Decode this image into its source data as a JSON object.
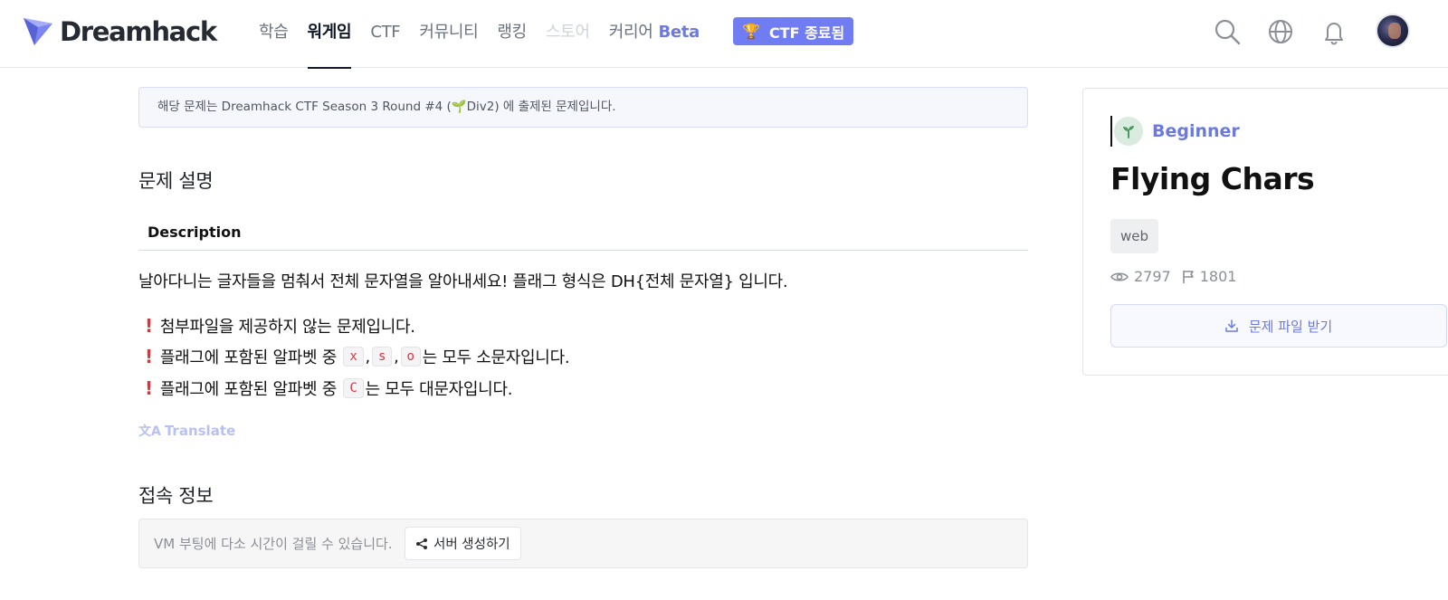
{
  "header": {
    "logo_text": "Dreamhack",
    "nav": [
      {
        "label": "학습"
      },
      {
        "label": "워게임"
      },
      {
        "label": "CTF"
      },
      {
        "label": "커뮤니티"
      },
      {
        "label": "랭킹"
      },
      {
        "label": "스토어"
      },
      {
        "label": "커리어"
      }
    ],
    "beta_label": "Beta",
    "ctf_badge_label": "CTF 종료됨",
    "icons": [
      "search-icon",
      "globe-icon",
      "bell-icon",
      "avatar"
    ]
  },
  "notice": {
    "text": "해당 문제는 Dreamhack CTF Season 3 Round #4 (🌱Div2) 에 출제된 문제입니다."
  },
  "problem": {
    "section_title": "문제 설명",
    "desc_heading": "Description",
    "desc_text": "날아다니는 글자들을 멈춰서 전체 문자열을 알아내세요! 플래그 형식은 DH{전체 문자열} 입니다.",
    "bullets": {
      "b1": "첨부파일을 제공하지 않는 문제입니다.",
      "b2_prefix": "플래그에 포함된 알파벳 중",
      "b2_tokens": [
        "x",
        "s",
        "o"
      ],
      "b2_suffix": "는 모두 소문자입니다.",
      "b3_prefix": "플래그에 포함된 알파벳 중",
      "b3_token": "C",
      "b3_suffix": "는 모두 대문자입니다."
    },
    "translate_label": "Translate"
  },
  "connection": {
    "section_title": "접속 정보",
    "vm_text": "VM 부팅에 다소 시간이 걸릴 수 있습니다.",
    "server_button": "서버 생성하기"
  },
  "card": {
    "level": "Beginner",
    "title": "Flying Chars",
    "tag": "web",
    "views": "2797",
    "solves": "1801",
    "download_button": "문제 파일 받기"
  },
  "colors": {
    "accent": "#6c7ae0",
    "ctf_badge": "#6f7cf2",
    "danger": "#e0323b",
    "beginner_badge": "#d9ecdf"
  }
}
